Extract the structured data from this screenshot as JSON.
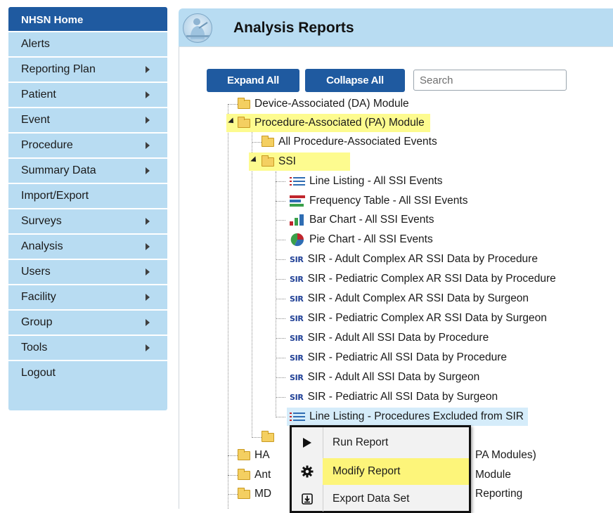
{
  "sidebar": {
    "home": "NHSN Home",
    "items": [
      {
        "label": "Alerts",
        "arrow": false
      },
      {
        "label": "Reporting Plan",
        "arrow": true
      },
      {
        "label": "Patient",
        "arrow": true
      },
      {
        "label": "Event",
        "arrow": true
      },
      {
        "label": "Procedure",
        "arrow": true
      },
      {
        "label": "Summary Data",
        "arrow": true
      },
      {
        "label": "Import/Export",
        "arrow": false
      },
      {
        "label": "Surveys",
        "arrow": true
      },
      {
        "label": "Analysis",
        "arrow": true
      },
      {
        "label": "Users",
        "arrow": true
      },
      {
        "label": "Facility",
        "arrow": true
      },
      {
        "label": "Group",
        "arrow": true
      },
      {
        "label": "Tools",
        "arrow": true
      },
      {
        "label": "Logout",
        "arrow": false
      }
    ]
  },
  "header": {
    "title": "Analysis Reports"
  },
  "toolbar": {
    "expand_all": "Expand All",
    "collapse_all": "Collapse All",
    "search_placeholder": "Search"
  },
  "tree": {
    "da_module": "Device-Associated (DA) Module",
    "pa_module": "Procedure-Associated (PA) Module",
    "all_pa_events": "All Procedure-Associated Events",
    "ssi": "SSI",
    "sir_badge": "SIR",
    "reports": [
      {
        "icon": "line-listing",
        "label": "Line Listing - All SSI Events"
      },
      {
        "icon": "frequency-table",
        "label": "Frequency Table - All SSI Events"
      },
      {
        "icon": "bar-chart",
        "label": "Bar Chart - All SSI Events"
      },
      {
        "icon": "pie-chart",
        "label": "Pie Chart - All SSI Events"
      },
      {
        "icon": "sir",
        "label": "SIR - Adult Complex AR SSI Data by Procedure"
      },
      {
        "icon": "sir",
        "label": "SIR - Pediatric Complex AR SSI Data by Procedure"
      },
      {
        "icon": "sir",
        "label": "SIR - Adult Complex AR SSI Data by Surgeon"
      },
      {
        "icon": "sir",
        "label": "SIR - Pediatric Complex AR SSI Data by Surgeon"
      },
      {
        "icon": "sir",
        "label": "SIR - Adult All SSI Data by Procedure"
      },
      {
        "icon": "sir",
        "label": "SIR - Pediatric All SSI Data by Procedure"
      },
      {
        "icon": "sir",
        "label": "SIR - Adult All SSI Data by Surgeon"
      },
      {
        "icon": "sir",
        "label": "SIR - Pediatric All SSI Data by Surgeon"
      },
      {
        "icon": "line-listing",
        "label": "Line Listing - Procedures Excluded from SIR"
      }
    ],
    "partial_rows": [
      "HA",
      "PA Modules)",
      "Ant",
      "Module",
      "MD",
      "Reporting"
    ]
  },
  "context_menu": {
    "items": [
      {
        "icon": "play-icon",
        "label": "Run Report"
      },
      {
        "icon": "gear-icon",
        "label": "Modify Report"
      },
      {
        "icon": "export-icon",
        "label": "Export Data Set"
      }
    ]
  },
  "colors": {
    "nav_home": "#1f5aa0",
    "sidebar_bg": "#b8dcf2",
    "highlight": "#fdfb8f",
    "selected": "#d5ecfa",
    "button": "#1f5aa0"
  }
}
